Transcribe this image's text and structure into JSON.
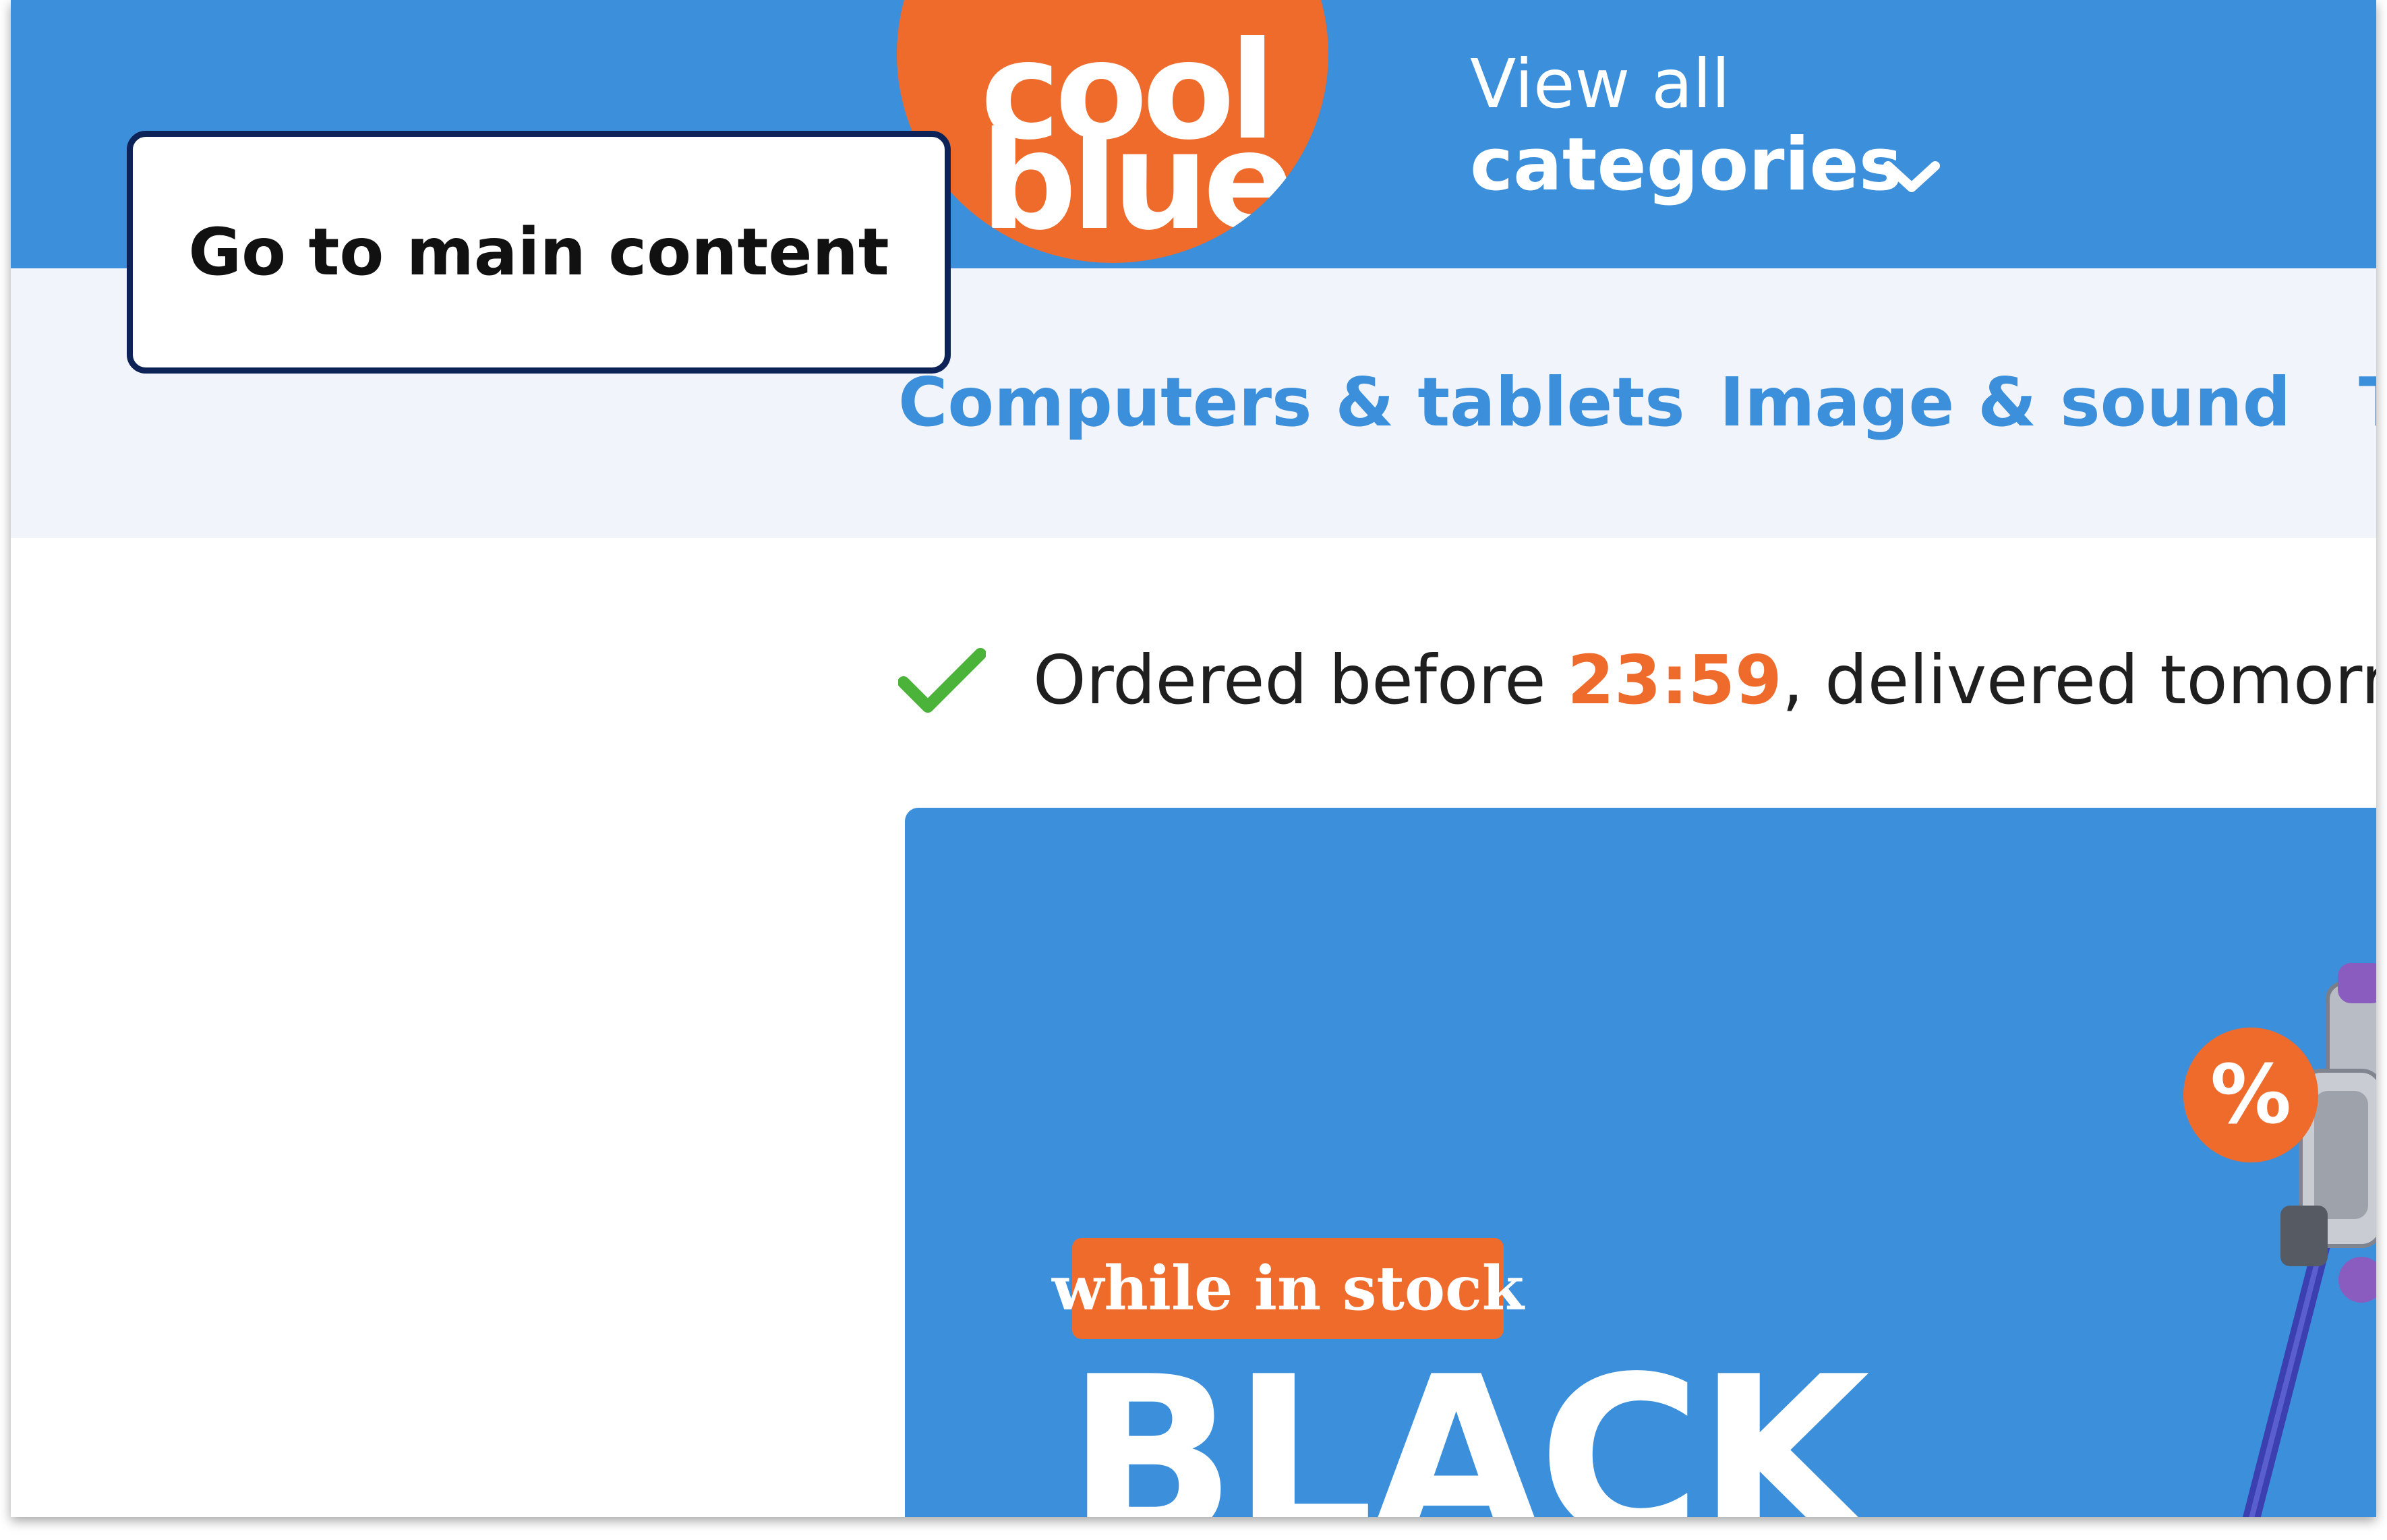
{
  "header": {
    "logo_line1": "cool",
    "logo_line2": "blue",
    "view_all": "View all",
    "categories": "categories"
  },
  "skip_link": "Go to main content",
  "nav": {
    "items": [
      {
        "label": "Computers & tablets"
      },
      {
        "label": "Image & sound"
      },
      {
        "label": "T"
      }
    ]
  },
  "usp": {
    "before": "Ordered before ",
    "time": "23:59",
    "after": ", delivered tomorrow"
  },
  "banner": {
    "badge": "while in stock",
    "headline": "BLACK",
    "percent": "%"
  },
  "icons": {
    "chevron": "chevron-down-icon",
    "check": "check-icon",
    "vacuum": "stick-vacuum-image"
  },
  "colors": {
    "brand_blue": "#3b8fdb",
    "brand_orange": "#ef6b2c",
    "check_green": "#4bb23a",
    "skip_border": "#0d2358"
  }
}
